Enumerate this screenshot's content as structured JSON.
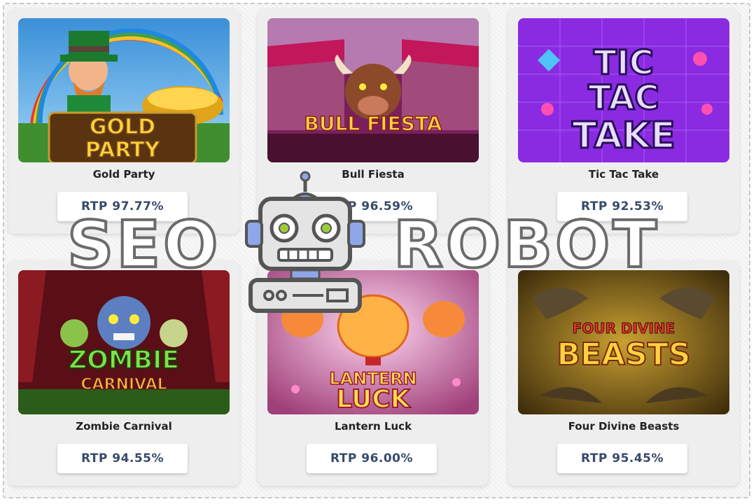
{
  "games": [
    {
      "name": "Gold Party",
      "rtp": "RTP 97.77%",
      "art_text": [
        "GOLD",
        "PARTY"
      ]
    },
    {
      "name": "Bull Fiesta",
      "rtp": "RTP 96.59%",
      "art_text": [
        "BULL FIESTA"
      ]
    },
    {
      "name": "Tic Tac Take",
      "rtp": "RTP 92.53%",
      "art_text": [
        "TIC",
        "TAC",
        "TAKE"
      ]
    },
    {
      "name": "Zombie Carnival",
      "rtp": "RTP 94.55%",
      "art_text": [
        "ZOMBIE",
        "CARNIVAL"
      ]
    },
    {
      "name": "Lantern Luck",
      "rtp": "RTP 96.00%",
      "art_text": [
        "LANTERN",
        "LUCK"
      ]
    },
    {
      "name": "Four Divine Beasts",
      "rtp": "RTP 95.45%",
      "art_text": [
        "FOUR DIVINE",
        "BEASTS"
      ]
    }
  ],
  "watermark": {
    "left": "SEO",
    "right": "ROBOT",
    "icon": "robot-icon"
  },
  "colors": {
    "rtp_text": "#374a6b",
    "card_bg": "#eeeeee"
  }
}
